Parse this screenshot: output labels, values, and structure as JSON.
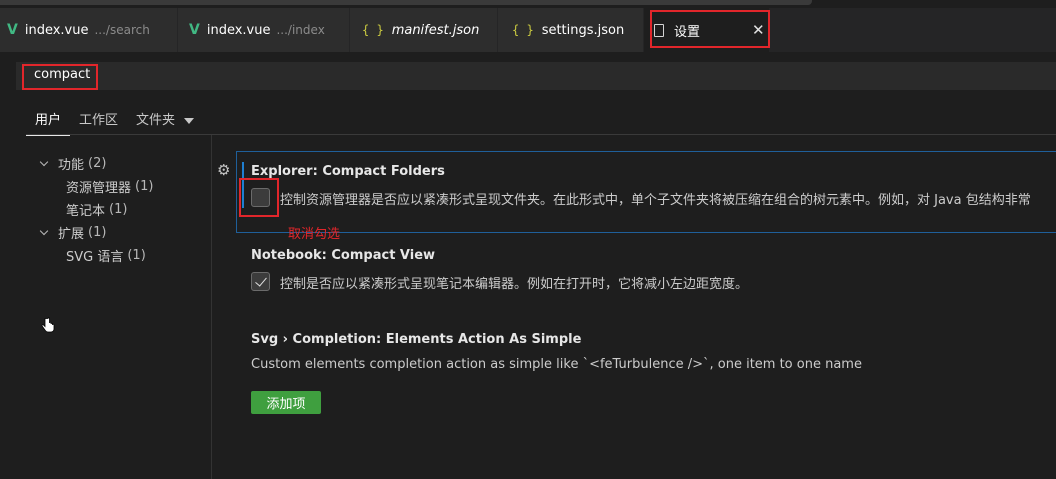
{
  "tabs": [
    {
      "icon": "vue-icon",
      "name": "index.vue",
      "desc": ".../search"
    },
    {
      "icon": "vue-icon",
      "name": "index.vue",
      "desc": ".../index"
    },
    {
      "icon": "json-braces-icon",
      "name": "manifest.json",
      "desc": ""
    },
    {
      "icon": "json-braces-icon",
      "name": "settings.json",
      "desc": ""
    },
    {
      "icon": "file-icon",
      "name": "设置",
      "desc": "",
      "active": true
    }
  ],
  "glyphs": {
    "vue": "V",
    "braces": "{ }",
    "close": "✕",
    "gear": "⚙"
  },
  "search": {
    "value": "compact"
  },
  "scope_tabs": {
    "user": "用户",
    "workspace": "工作区",
    "folder": "文件夹"
  },
  "tree": {
    "features": {
      "label": "功能",
      "count": "(2)"
    },
    "explorer": {
      "label": "资源管理器",
      "count": "(1)"
    },
    "notebook": {
      "label": "笔记本",
      "count": "(1)"
    },
    "extensions": {
      "label": "扩展",
      "count": "(1)"
    },
    "svg_lang": {
      "label": "SVG 语言",
      "count": "(1)"
    }
  },
  "settings": {
    "explorer_compact": {
      "category": "Explorer: ",
      "name": "Compact Folders",
      "description": "控制资源管理器是否应以紧凑形式呈现文件夹。在此形式中，单个子文件夹将被压缩在组合的树元素中。例如，对 Java 包结构非常",
      "checked": false
    },
    "notebook_compact": {
      "category": "Notebook: ",
      "name": "Compact View",
      "description": "控制是否应以紧凑形式呈现笔记本编辑器。例如在打开时，它将减小左边距宽度。",
      "checked": true
    },
    "svg_completion": {
      "category": "Svg › Completion: ",
      "name": "Elements Action As Simple",
      "description": "Custom elements completion action as simple like `<feTurbulence />`, one item to one name",
      "button_label": "添加项"
    }
  },
  "annotation": "取消勾选",
  "colors": {
    "highlight": "#e2262b",
    "accent": "#1f7fd1",
    "add_button": "#3f9f3f",
    "background": "#1e1e1e"
  }
}
